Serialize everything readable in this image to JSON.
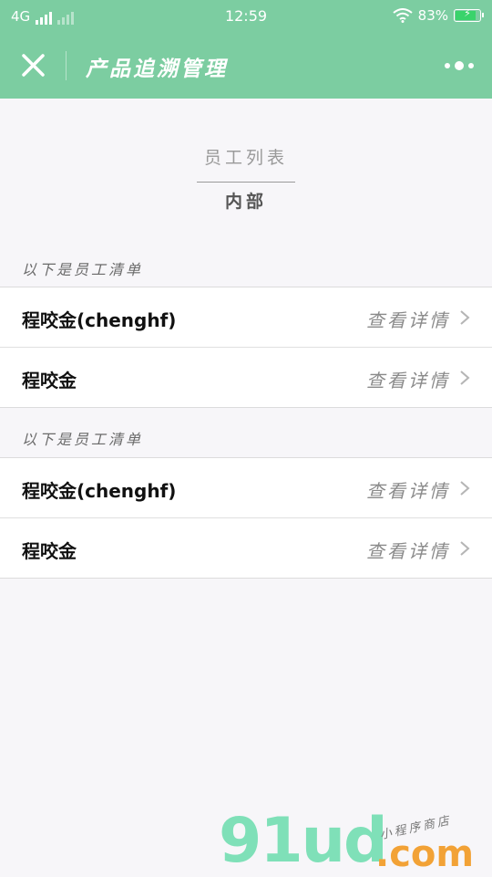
{
  "status_bar": {
    "network": "4G",
    "time": "12:59",
    "battery": "83%"
  },
  "navbar": {
    "title": "产品追溯管理",
    "close_icon": "close-icon",
    "more_icon": "more-icon"
  },
  "header": {
    "list_title": "员工列表",
    "tab": "内部"
  },
  "sections": [
    {
      "label": "以下是员工清单",
      "rows": [
        {
          "name": "程咬金(chenghf)",
          "detail": "查看详情"
        },
        {
          "name": "程咬金",
          "detail": "查看详情"
        }
      ]
    },
    {
      "label": "以下是员工清单",
      "rows": [
        {
          "name": "程咬金(chenghf)",
          "detail": "查看详情"
        },
        {
          "name": "程咬金",
          "detail": "查看详情"
        }
      ]
    }
  ],
  "watermark": {
    "brand": "91ud",
    "domain": ".com",
    "tagline": "小程序商店"
  },
  "colors": {
    "accent": "#7ccda1",
    "background": "#f7f6f9",
    "battery": "#39d36b"
  }
}
